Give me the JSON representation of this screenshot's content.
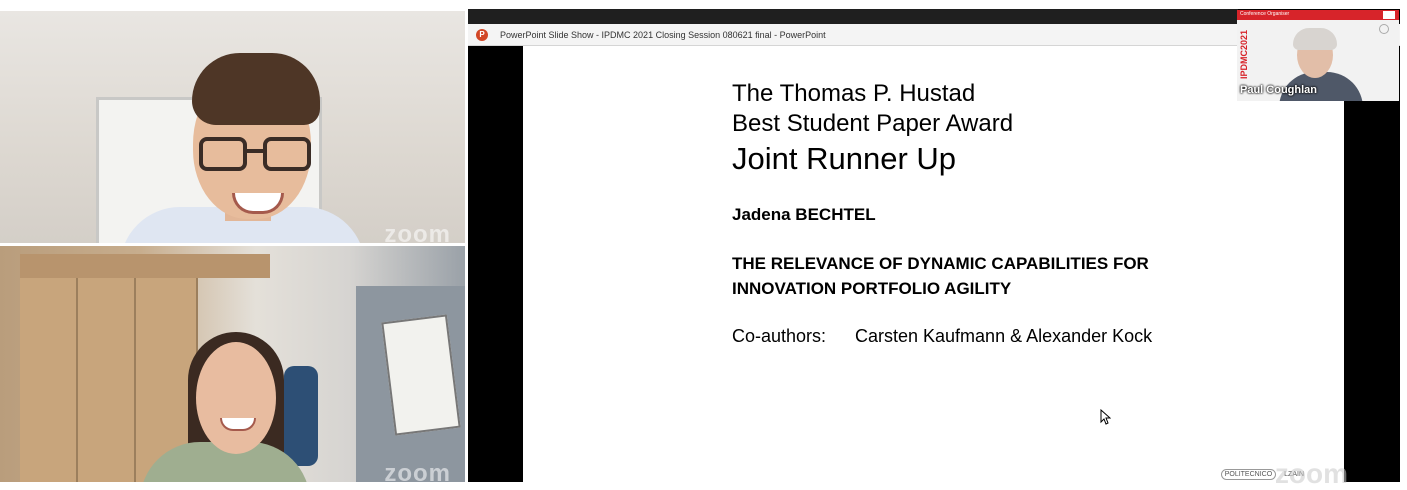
{
  "participants": {
    "top": {
      "watermark": "zoom"
    },
    "bottom": {
      "watermark": "zoom"
    }
  },
  "share": {
    "window_title": "PowerPoint Slide Show  -  IPDMC 2021 Closing Session 080621 final - PowerPoint",
    "slide": {
      "title_line1": "The Thomas P. Hustad",
      "title_line2": "Best Student Paper Award",
      "title_line3": "Joint Runner Up",
      "author": "Jadena BECHTEL",
      "paper_line1": "THE RELEVANCE OF DYNAMIC CAPABILITIES FOR",
      "paper_line2": "INNOVATION PORTFOLIO AGILITY",
      "coauthors_label": "Co-authors:",
      "coauthors_names": "Carsten Kaufmann & Alexander Kock",
      "logo_a": "POLITECNICO",
      "logo_b": "LZAIN"
    },
    "watermark": "zoom"
  },
  "presenter": {
    "badge": "Conference Organiser",
    "event": "IPDMC2021",
    "name": "Paul Coughlan"
  },
  "colors": {
    "accent_red": "#d7242a",
    "powerpoint_icon": "#d24726"
  }
}
